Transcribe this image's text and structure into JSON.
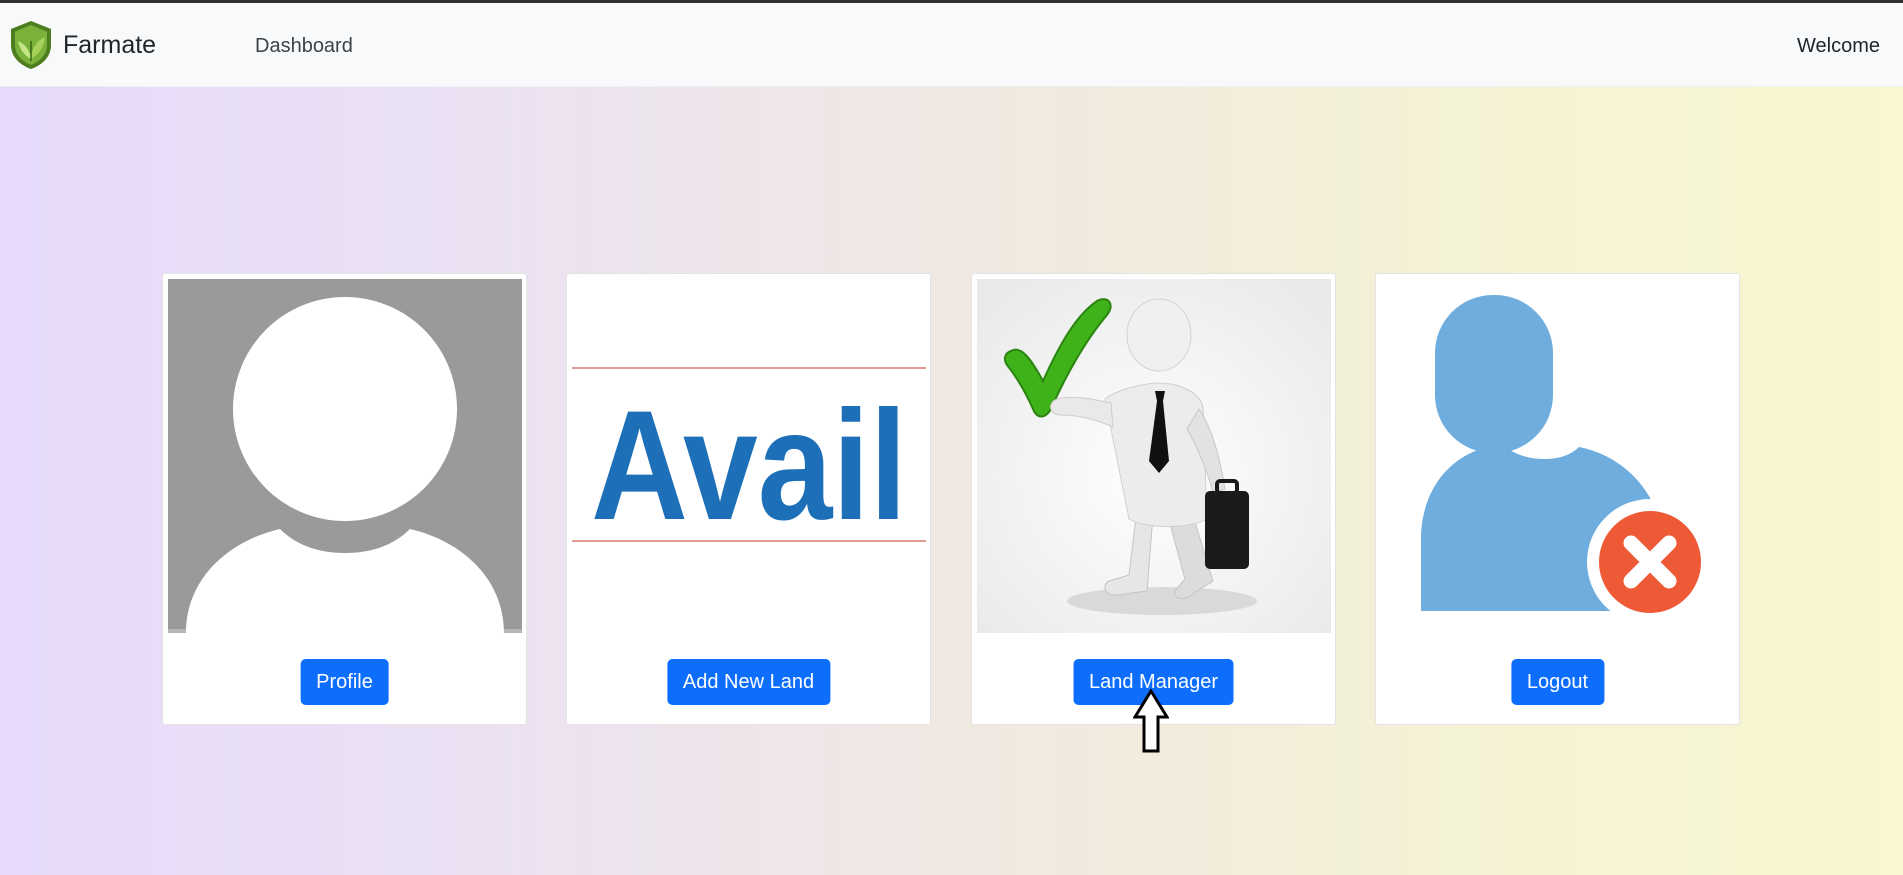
{
  "navbar": {
    "brand_name": "Farmate",
    "brand_icon": "leaf-shield-icon",
    "dashboard_label": "Dashboard",
    "welcome_label": "Welcome"
  },
  "cards": [
    {
      "image": "default-avatar-image",
      "button_label": "Profile"
    },
    {
      "image": "avail-logo-image",
      "image_text": "Avail",
      "button_label": "Add New Land"
    },
    {
      "image": "businessman-checkmark-image",
      "button_label": "Land Manager"
    },
    {
      "image": "remove-user-image",
      "button_label": "Logout"
    }
  ],
  "cursor": "up-arrow-cursor-icon",
  "colors": {
    "primary_button": "#0d6efd",
    "navbar_bg": "#f8f9fa",
    "avail_blue": "#1d6fb8",
    "logout_icon_blue": "#6eaddd",
    "logout_x_red": "#ee5a35"
  }
}
